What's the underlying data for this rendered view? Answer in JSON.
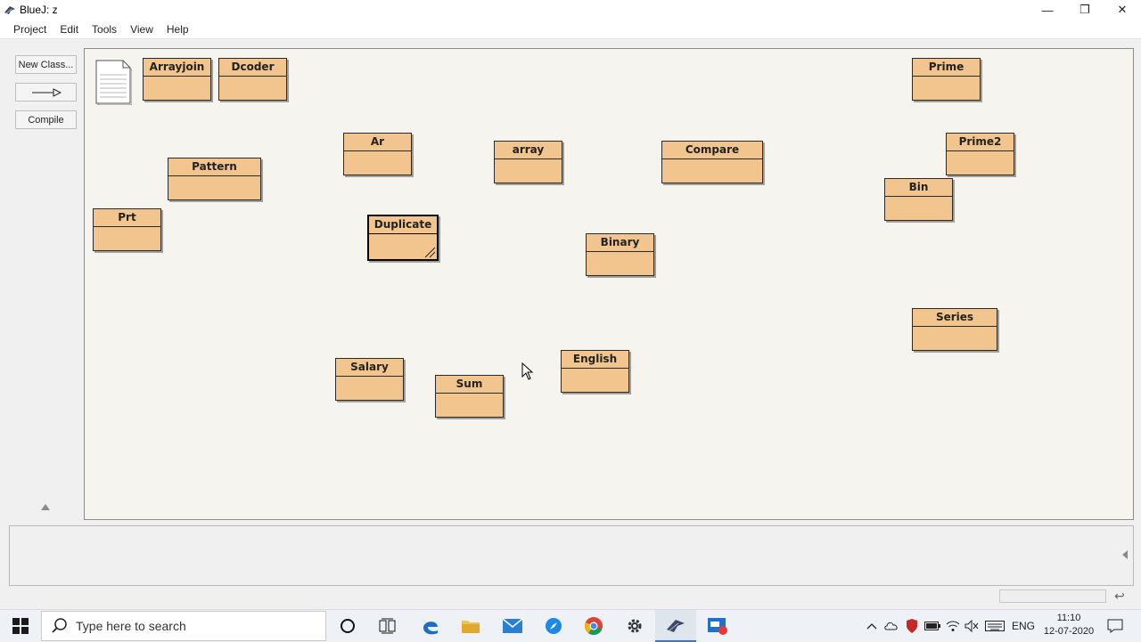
{
  "window": {
    "title": "BlueJ: z",
    "minimize": "—",
    "restore": "❐",
    "close": "✕"
  },
  "menu": [
    "Project",
    "Edit",
    "Tools",
    "View",
    "Help"
  ],
  "toolbar": {
    "new_class": "New Class...",
    "arrow": "—▷",
    "compile": "Compile"
  },
  "classes": [
    {
      "name": "Arrayjoin"
    },
    {
      "name": "Dcoder"
    },
    {
      "name": "Prime"
    },
    {
      "name": "Ar"
    },
    {
      "name": "array"
    },
    {
      "name": "Compare"
    },
    {
      "name": "Prime2"
    },
    {
      "name": "Pattern"
    },
    {
      "name": "Bin"
    },
    {
      "name": "Prt"
    },
    {
      "name": "Duplicate"
    },
    {
      "name": "Binary"
    },
    {
      "name": "Series"
    },
    {
      "name": "Salary"
    },
    {
      "name": "Sum"
    },
    {
      "name": "English"
    }
  ],
  "taskbar": {
    "search_placeholder": "Type here to search",
    "language": "ENG",
    "time": "11:10",
    "date": "12-07-2020"
  },
  "colors": {
    "class_fill": "#f3c58e",
    "canvas": "#f5f4ef",
    "taskbar": "#eef2f6"
  }
}
